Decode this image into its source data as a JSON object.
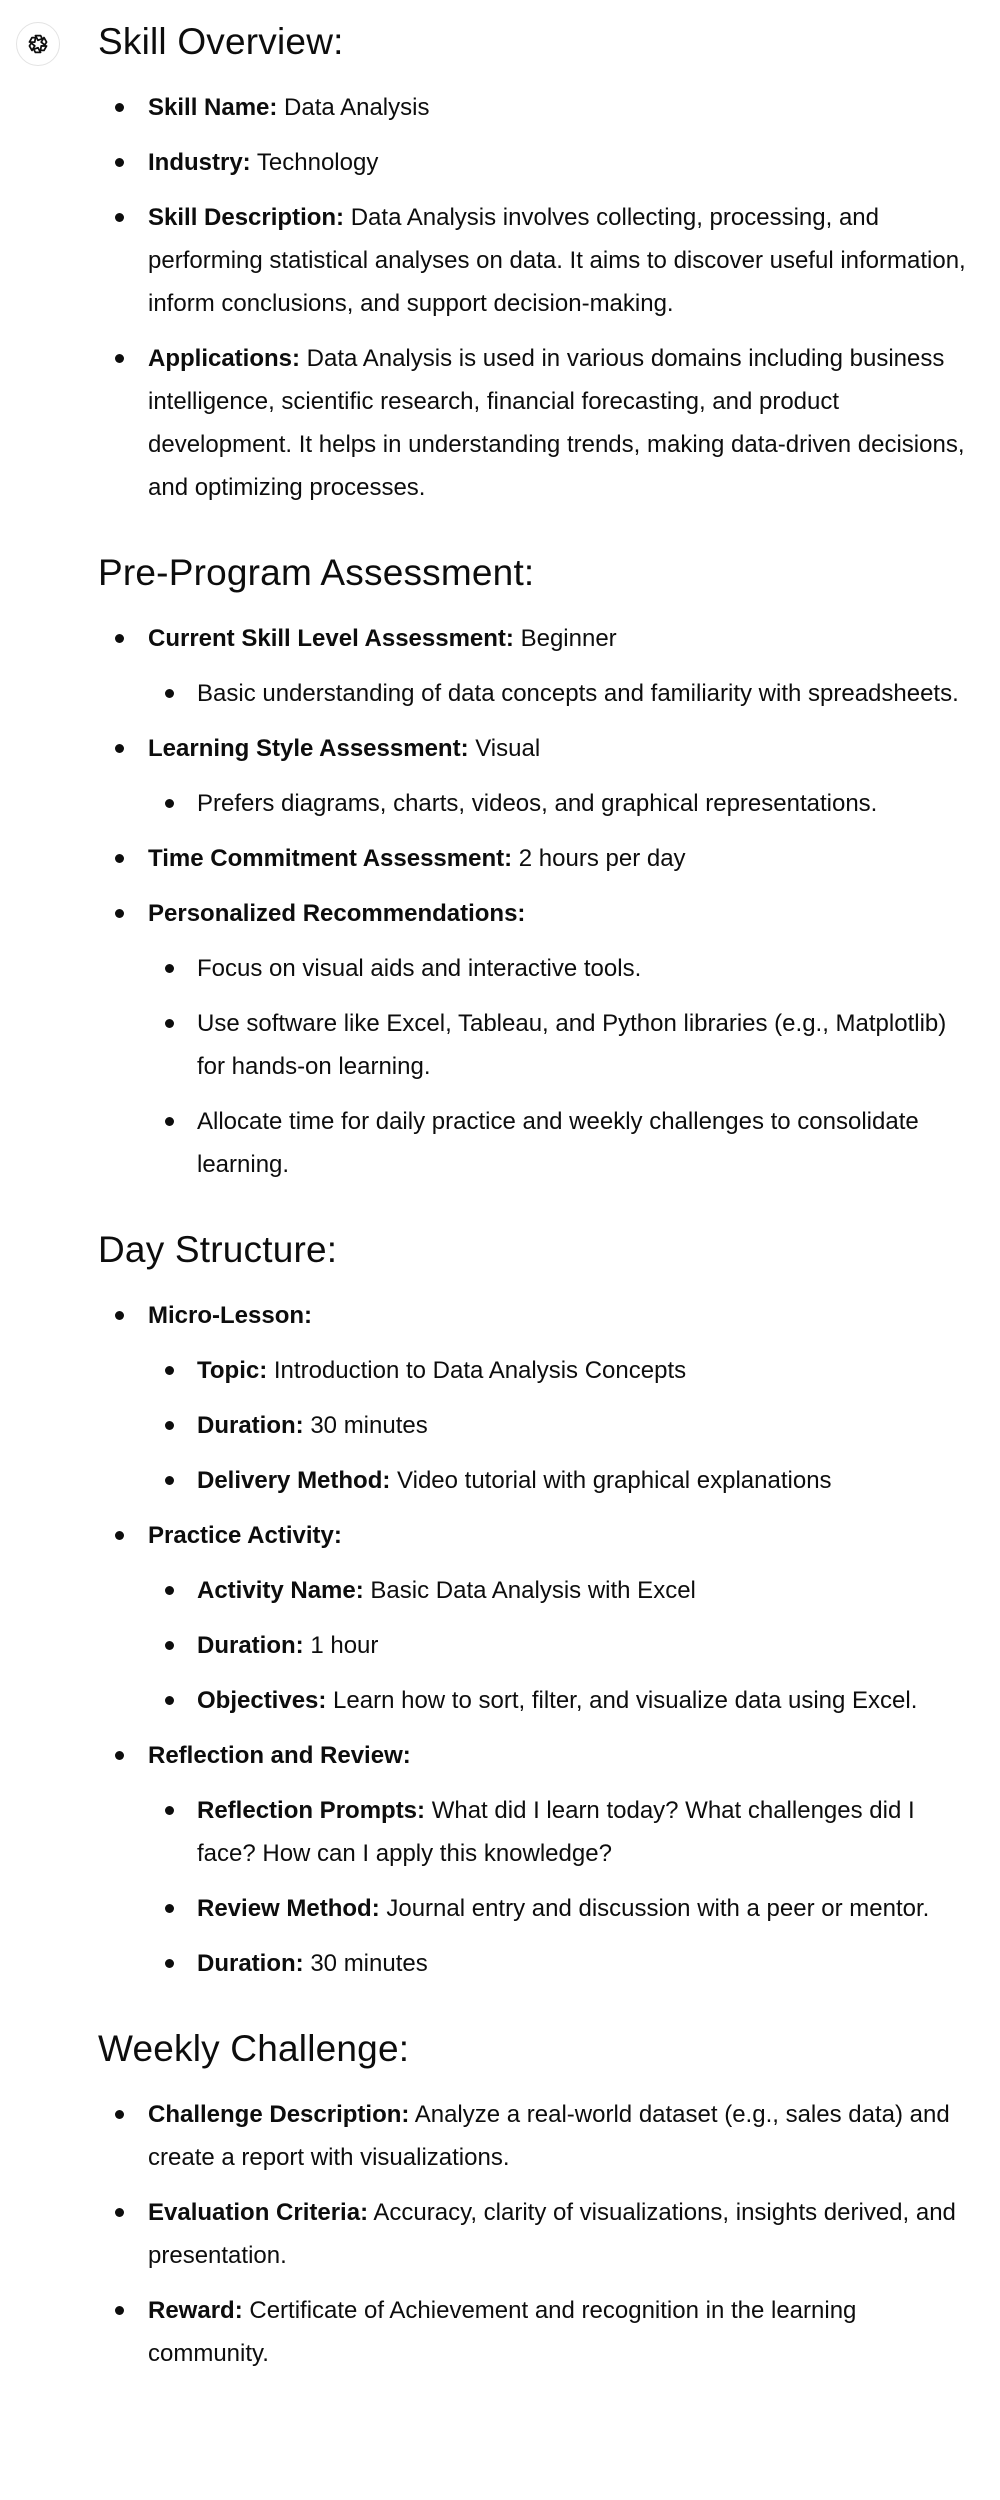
{
  "skill_overview": {
    "heading": "Skill Overview:",
    "items": [
      {
        "label": "Skill Name:",
        "text": " Data Analysis"
      },
      {
        "label": "Industry:",
        "text": " Technology"
      },
      {
        "label": "Skill Description:",
        "text": " Data Analysis involves collecting, processing, and performing statistical analyses on data. It aims to discover useful information, inform conclusions, and support decision-making."
      },
      {
        "label": "Applications:",
        "text": " Data Analysis is used in various domains including business intelligence, scientific research, financial forecasting, and product development. It helps in understanding trends, making data-driven decisions, and optimizing processes."
      }
    ]
  },
  "pre_program": {
    "heading": "Pre-Program Assessment:",
    "items": [
      {
        "label": "Current Skill Level Assessment:",
        "text": " Beginner",
        "sub": [
          "Basic understanding of data concepts and familiarity with spreadsheets."
        ]
      },
      {
        "label": "Learning Style Assessment:",
        "text": " Visual",
        "sub": [
          "Prefers diagrams, charts, videos, and graphical representations."
        ]
      },
      {
        "label": "Time Commitment Assessment:",
        "text": " 2 hours per day"
      },
      {
        "label": "Personalized Recommendations:",
        "text": "",
        "sub": [
          "Focus on visual aids and interactive tools.",
          "Use software like Excel, Tableau, and Python libraries (e.g., Matplotlib) for hands-on learning.",
          "Allocate time for daily practice and weekly challenges to consolidate learning."
        ]
      }
    ]
  },
  "day_structure": {
    "heading": "Day Structure:",
    "micro_lesson": {
      "label": "Micro-Lesson:",
      "topic_label": "Topic:",
      "topic": " Introduction to Data Analysis Concepts",
      "duration_label": "Duration:",
      "duration": " 30 minutes",
      "method_label": "Delivery Method:",
      "method": " Video tutorial with graphical explanations"
    },
    "practice": {
      "label": "Practice Activity:",
      "name_label": "Activity Name:",
      "name": " Basic Data Analysis with Excel",
      "duration_label": "Duration:",
      "duration": " 1 hour",
      "objectives_label": "Objectives:",
      "objectives": " Learn how to sort, filter, and visualize data using Excel."
    },
    "reflection": {
      "label": "Reflection and Review:",
      "prompts_label": "Reflection Prompts:",
      "prompts": " What did I learn today? What challenges did I face? How can I apply this knowledge?",
      "method_label": "Review Method:",
      "method": " Journal entry and discussion with a peer or mentor.",
      "duration_label": "Duration:",
      "duration": " 30 minutes"
    }
  },
  "weekly_challenge": {
    "heading": "Weekly Challenge:",
    "items": [
      {
        "label": "Challenge Description:",
        "text": " Analyze a real-world dataset (e.g., sales data) and create a report with visualizations."
      },
      {
        "label": "Evaluation Criteria:",
        "text": " Accuracy, clarity of visualizations, insights derived, and presentation."
      },
      {
        "label": "Reward:",
        "text": " Certificate of Achievement and recognition in the learning community."
      }
    ]
  }
}
